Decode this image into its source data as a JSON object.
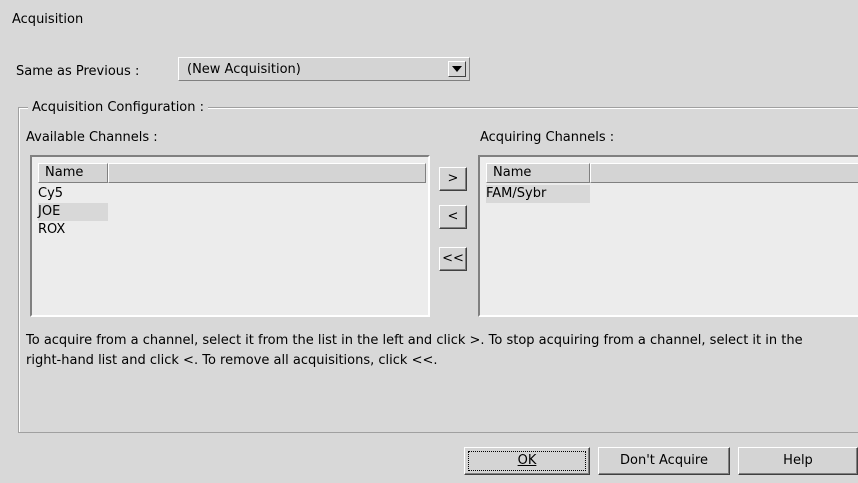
{
  "window": {
    "title": "Acquisition"
  },
  "same_as_previous": {
    "label": "Same as Previous :",
    "value": "(New Acquisition)"
  },
  "config": {
    "group_title": "Acquisition Configuration :",
    "available_label": "Available Channels :",
    "acquiring_label": "Acquiring Channels :",
    "column_header": "Name",
    "available_channels": [
      "Cy5",
      "JOE",
      "ROX"
    ],
    "acquiring_channels": [
      "FAM/Sybr"
    ],
    "buttons": {
      "add": ">",
      "remove": "<",
      "remove_all": "<<"
    },
    "hint": "To acquire from a channel, select it from the list in the left and click >. To stop acquiring from a channel, select it in the right-hand list and click <. To remove all acquisitions, click <<."
  },
  "footer": {
    "ok": "OK",
    "dont_acquire": "Don't Acquire",
    "help": "Help"
  }
}
